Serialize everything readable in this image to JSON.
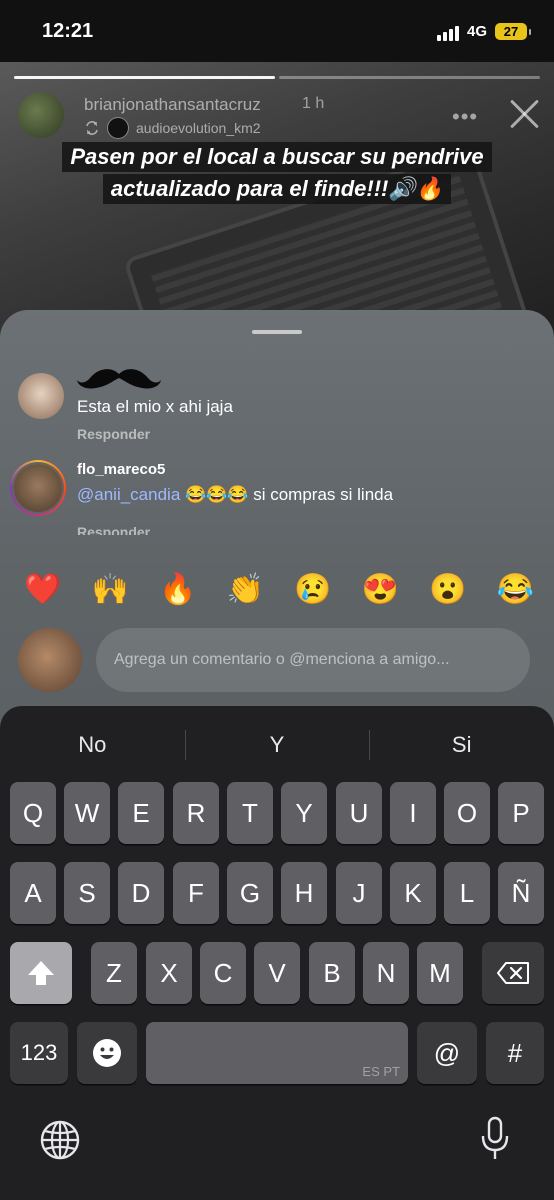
{
  "status_bar": {
    "time": "12:21",
    "network": "4G",
    "battery": "27"
  },
  "story": {
    "username": "brianjonathansantacruz",
    "time_ago": "1 h",
    "reposted_from": "audioevolution_km2",
    "caption_line1": "Pasen por el local a buscar su pendrive",
    "caption_line2": "actualizado para el finde!!!🔊🔥",
    "more_icon": "more-dots-icon",
    "close_icon": "close-icon"
  },
  "comments": [
    {
      "user": "",
      "text": "Esta el mio x ahi jaja",
      "reply": "Responder"
    },
    {
      "user": "flo_mareco5",
      "mention": "@anii_candia",
      "text": " 😂😂😂 si compras si linda",
      "reply": "Responder"
    }
  ],
  "reactions": [
    "❤️",
    "🙌",
    "🔥",
    "👏",
    "😢",
    "😍",
    "😮",
    "😂"
  ],
  "composer": {
    "placeholder": "Agrega un comentario o @menciona a amigo..."
  },
  "keyboard": {
    "suggestions": [
      "No",
      "Y",
      "Si"
    ],
    "row1": [
      "Q",
      "W",
      "E",
      "R",
      "T",
      "Y",
      "U",
      "I",
      "O",
      "P"
    ],
    "row2": [
      "A",
      "S",
      "D",
      "F",
      "G",
      "H",
      "J",
      "K",
      "L",
      "Ñ"
    ],
    "row3": [
      "Z",
      "X",
      "C",
      "V",
      "B",
      "N",
      "M"
    ],
    "numbers_key": "123",
    "space_langs": "ES PT",
    "at_key": "@",
    "hash_key": "#"
  }
}
